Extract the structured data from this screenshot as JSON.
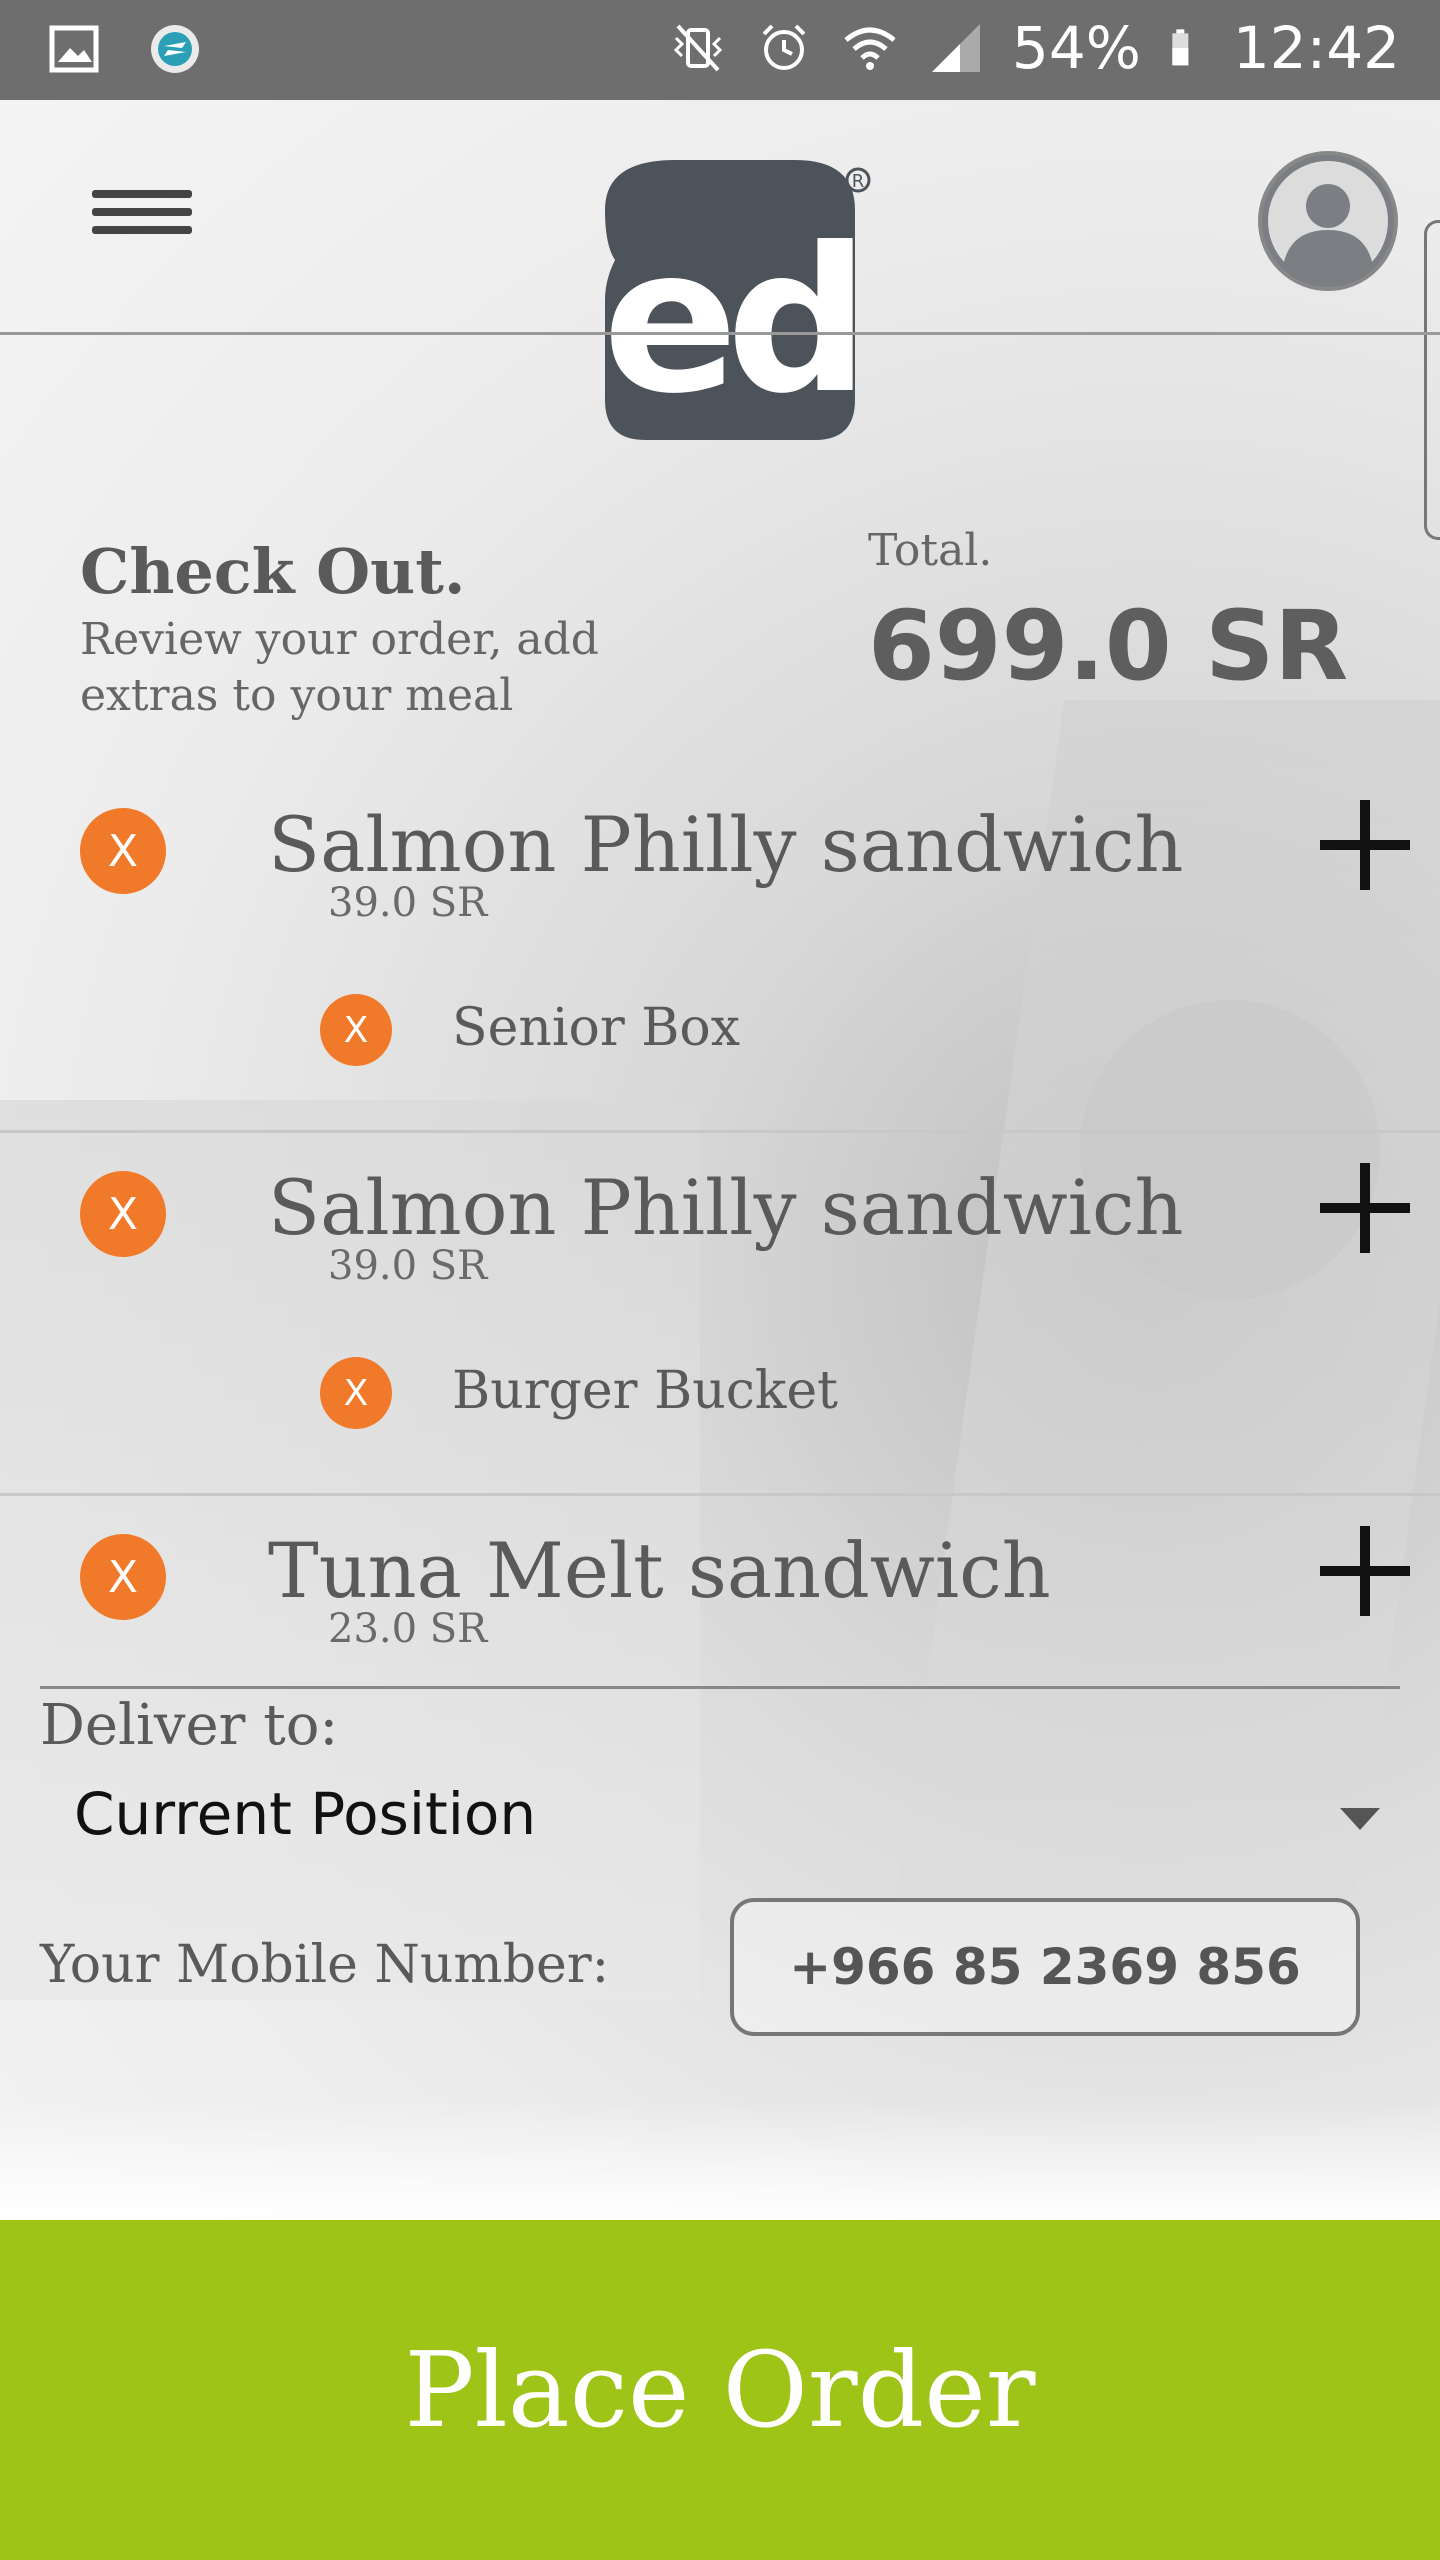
{
  "status_bar": {
    "battery": "54%",
    "time": "12:42"
  },
  "header": {
    "logo_text": "ed",
    "registered_mark": "®"
  },
  "checkout": {
    "title": "Check Out.",
    "subtitle": "Review your order, add extras to your meal",
    "total_label": "Total.",
    "total_value": "699.0 SR"
  },
  "orders": [
    {
      "name": "Salmon Philly sandwich",
      "price": "39.0 SR",
      "extra": "Senior Box",
      "remove_label": "X"
    },
    {
      "name": "Salmon Philly sandwich",
      "price": "39.0 SR",
      "extra": "Burger Bucket",
      "remove_label": "X"
    },
    {
      "name": "Tuna Melt sandwich",
      "price": "23.0 SR",
      "remove_label": "X"
    }
  ],
  "extra_remove_label": "X",
  "delivery": {
    "label": "Deliver to:",
    "selected": "Current Position"
  },
  "mobile": {
    "label": "Your Mobile Number:",
    "value": "+966 85 2369 856"
  },
  "place_order_label": "Place Order",
  "colors": {
    "accent_green": "#9fc418",
    "remove_orange": "#f07a2a",
    "status_bar": "#6e6e6e"
  }
}
